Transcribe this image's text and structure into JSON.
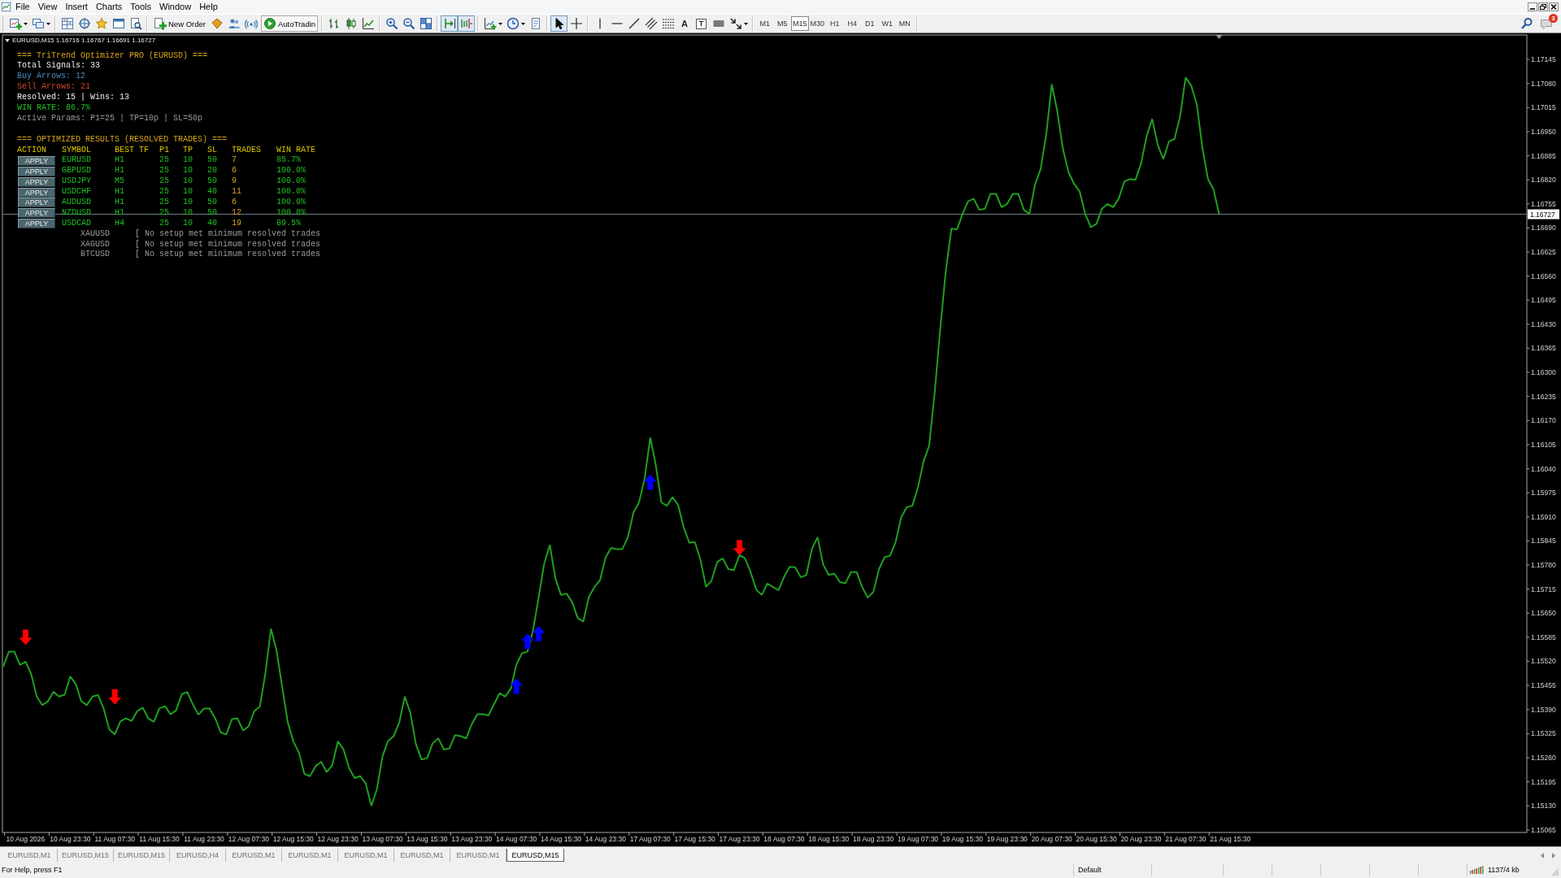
{
  "menu": [
    "File",
    "View",
    "Insert",
    "Charts",
    "Tools",
    "Window",
    "Help"
  ],
  "toolbar": {
    "new_order": "New Order",
    "autotrading": "AutoTradin",
    "autoscroll_on": true,
    "chart_shift_on": true,
    "cursor_modes": [
      {
        "kind": "cursor",
        "selected": true
      },
      {
        "kind": "crosshair",
        "selected": false
      }
    ],
    "text_tool": "A",
    "label_tool": "T",
    "timeframes": [
      {
        "label": "M1",
        "selected": false
      },
      {
        "label": "M5",
        "selected": false
      },
      {
        "label": "M15",
        "selected": true
      },
      {
        "label": "M30",
        "selected": false
      },
      {
        "label": "H1",
        "selected": false
      },
      {
        "label": "H4",
        "selected": false
      },
      {
        "label": "D1",
        "selected": false
      },
      {
        "label": "W1",
        "selected": false
      },
      {
        "label": "MN",
        "selected": false
      }
    ],
    "notifications": "3"
  },
  "chart": {
    "header": "EURUSD,M15 1.16716 1.16767 1.16691 1.16727",
    "chart_data": {
      "type": "line",
      "categories": [
        null,
        null,
        null,
        null,
        "10 Aug 2026",
        null,
        null,
        null,
        null,
        null,
        null,
        null,
        "10 Aug 23:30",
        null,
        null,
        null,
        null,
        null,
        null,
        null,
        "11 Aug 07:30",
        null,
        null,
        null,
        null,
        null,
        null,
        null,
        "11 Aug 15:30",
        null,
        null,
        null,
        null,
        null,
        null,
        null,
        "11 Aug 23:30",
        null,
        null,
        null,
        null,
        null,
        null,
        null,
        "12 Aug 07:30",
        null,
        null,
        null,
        null,
        null,
        null,
        null,
        "12 Aug 15:30",
        null,
        null,
        null,
        null,
        null,
        null,
        null,
        "12 Aug 23:30",
        null,
        null,
        null,
        null,
        null,
        null,
        null,
        "13 Aug 07:30",
        null,
        null,
        null,
        null,
        null,
        null,
        null,
        "13 Aug 15:30",
        null,
        null,
        null,
        null,
        null,
        null,
        null,
        "13 Aug 23:30",
        null,
        null,
        null,
        null,
        null,
        null,
        null,
        "14 Aug 07:30",
        null,
        null,
        null,
        null,
        null,
        null,
        null,
        "14 Aug 15:30",
        null,
        null,
        null,
        null,
        null,
        null,
        null,
        "14 Aug 23:30",
        null,
        null,
        null,
        null,
        null,
        null,
        null,
        "17 Aug 07:30",
        null,
        null,
        null,
        null,
        null,
        null,
        null,
        "17 Aug 15:30",
        null,
        null,
        null,
        null,
        null,
        null,
        null,
        "17 Aug 23:30",
        null,
        null,
        null,
        null,
        null,
        null,
        null,
        "18 Aug 07:30",
        null,
        null,
        null,
        null,
        null,
        null,
        null,
        "18 Aug 15:30",
        null,
        null,
        null,
        null,
        null,
        null,
        null,
        "18 Aug 23:30",
        null,
        null,
        null,
        null,
        null,
        null,
        null,
        "19 Aug 07:30",
        null,
        null,
        null,
        null,
        null,
        null,
        null,
        "19 Aug 15:30",
        null,
        null,
        null,
        null,
        null,
        null,
        null,
        "19 Aug 23:30",
        null,
        null,
        null,
        null,
        null,
        null,
        null,
        "20 Aug 07:30",
        null,
        null,
        null,
        null,
        null,
        null,
        null,
        "20 Aug 15:30",
        null,
        null,
        null,
        null,
        null,
        null,
        null,
        "20 Aug 23:30",
        null,
        null,
        null,
        null,
        null,
        null,
        null,
        "21 Aug 07:30",
        null,
        null,
        null,
        null,
        null,
        null,
        null,
        "21 Aug 15:30"
      ],
      "series": [
        {
          "type": "line",
          "color": "#1fa01f",
          "values": [
            1.15506,
            1.15546,
            1.15546,
            1.1551,
            1.15519,
            1.15486,
            1.15425,
            1.15402,
            1.15412,
            1.15438,
            1.15425,
            1.1543,
            1.15479,
            1.15459,
            1.15412,
            1.15402,
            1.15425,
            1.15429,
            1.15393,
            1.15336,
            1.15323,
            1.15358,
            1.15366,
            1.15359,
            1.15385,
            1.15395,
            1.15366,
            1.15357,
            1.15393,
            1.15399,
            1.15377,
            1.15388,
            1.15431,
            1.15437,
            1.15404,
            1.15376,
            1.15393,
            1.15393,
            1.15366,
            1.15328,
            1.15323,
            1.15364,
            1.15366,
            1.15333,
            1.15345,
            1.15385,
            1.15398,
            1.15487,
            1.15608,
            1.1555,
            1.15452,
            1.15356,
            1.15304,
            1.15274,
            1.15216,
            1.1521,
            1.15237,
            1.15249,
            1.15221,
            1.1524,
            1.15304,
            1.15282,
            1.15232,
            1.15205,
            1.1521,
            1.1519,
            1.1513,
            1.15175,
            1.15264,
            1.15305,
            1.15318,
            1.15355,
            1.15425,
            1.1538,
            1.15296,
            1.15255,
            1.15259,
            1.15299,
            1.15312,
            1.15282,
            1.15285,
            1.15321,
            1.15318,
            1.15312,
            1.1535,
            1.15377,
            1.15377,
            1.15374,
            1.15404,
            1.15434,
            1.15425,
            1.15446,
            1.15511,
            1.15542,
            1.15546,
            1.15604,
            1.15694,
            1.15784,
            1.15834,
            1.15744,
            1.15699,
            1.15703,
            1.1568,
            1.15637,
            1.15627,
            1.15694,
            1.15721,
            1.15739,
            1.15801,
            1.15826,
            1.15823,
            1.15823,
            1.15855,
            1.15922,
            1.15949,
            1.16014,
            1.16124,
            1.1605,
            1.15949,
            1.1594,
            1.15963,
            1.15942,
            1.15882,
            1.1584,
            1.15842,
            1.15795,
            1.15721,
            1.15738,
            1.15788,
            1.15798,
            1.15769,
            1.15766,
            1.15807,
            1.15798,
            1.15761,
            1.15714,
            1.15699,
            1.1573,
            1.15721,
            1.15712,
            1.15748,
            1.15775,
            1.15774,
            1.15747,
            1.15753,
            1.15824,
            1.15855,
            1.15782,
            1.15753,
            1.15757,
            1.15734,
            1.15731,
            1.15761,
            1.15761,
            1.15721,
            1.15692,
            1.15707,
            1.15768,
            1.15801,
            1.15805,
            1.15842,
            1.15909,
            1.15936,
            1.1594,
            1.15989,
            1.16059,
            1.16102,
            1.16244,
            1.16419,
            1.16573,
            1.16688,
            1.16686,
            1.16728,
            1.16762,
            1.16769,
            1.16739,
            1.16742,
            1.16782,
            1.16782,
            1.16746,
            1.16755,
            1.16782,
            1.16782,
            1.16739,
            1.16728,
            1.16808,
            1.16849,
            1.16941,
            1.17078,
            1.17004,
            1.16903,
            1.1684,
            1.16809,
            1.16788,
            1.16728,
            1.16692,
            1.16701,
            1.16742,
            1.16755,
            1.16746,
            1.16769,
            1.16815,
            1.16822,
            1.1682,
            1.16863,
            1.16937,
            1.16984,
            1.16914,
            1.16876,
            1.16923,
            1.1693,
            1.16991,
            1.17096,
            1.17074,
            1.17024,
            1.16907,
            1.16822,
            1.16794,
            1.16727,
            null,
            null
          ]
        }
      ],
      "yticks": [
        1.17145,
        {
          "value": 1.1708,
          "label": "1.17080"
        },
        1.17015,
        {
          "value": 1.1695,
          "label": "1.16950"
        },
        1.16885,
        {
          "value": 1.1682,
          "label": "1.16820"
        },
        1.16755,
        {
          "value": 1.1669,
          "label": "1.16690"
        },
        1.16625,
        {
          "value": 1.1656,
          "label": "1.16560"
        },
        1.16495,
        {
          "value": 1.1643,
          "label": "1.16430"
        },
        1.16365,
        {
          "value": 1.163,
          "label": "1.16300"
        },
        1.16235,
        {
          "value": 1.1617,
          "label": "1.16170"
        },
        1.16105,
        {
          "value": 1.1604,
          "label": "1.16040"
        },
        1.15975,
        {
          "value": 1.1591,
          "label": "1.15910"
        },
        1.15845,
        {
          "value": 1.1578,
          "label": "1.15780"
        },
        1.15715,
        {
          "value": 1.1565,
          "label": "1.15650"
        },
        1.15585,
        {
          "value": 1.1552,
          "label": "1.15520"
        },
        1.15455,
        {
          "value": 1.1539,
          "label": "1.15390"
        },
        1.15325,
        {
          "value": 1.1526,
          "label": "1.15260"
        },
        1.15195,
        {
          "value": 1.1513,
          "label": "1.15130"
        },
        1.15065
      ],
      "ylim": [
        1.15058,
        1.17211
      ],
      "ref_lines": [
        {
          "axis": "y",
          "value": 1.16727,
          "label": "1.16727",
          "color": "#6e7f8c"
        }
      ]
    }
  },
  "panel": {
    "title": "=== TriTrend Optimizer PRO (EURUSD) ===",
    "total_signals": "Total Signals: 33",
    "buy_arrows": "Buy Arrows: 12",
    "sell_arrows": "Sell Arrows: 21",
    "resolved": "Resolved: 15 | Wins: 13",
    "win_rate": "WIN RATE: 86.7%",
    "active_params": "Active Params: P1=25 | TP=10p | SL=50p",
    "results_title": "=== OPTIMIZED RESULTS (RESOLVED TRADES) ===",
    "columns": [
      "ACTION",
      "SYMBOL",
      "BEST TF",
      "P1",
      "TP",
      "SL",
      "TRADES",
      "WIN RATE"
    ],
    "rows": [
      {
        "action": "APPLY",
        "symbol": "EURUSD",
        "tf": "H1",
        "p1": "25",
        "tp": "10",
        "sl": "50",
        "trades": "7",
        "win_rate": "85.7%"
      },
      {
        "action": "APPLY",
        "symbol": "GBPUSD",
        "tf": "H1",
        "p1": "25",
        "tp": "10",
        "sl": "20",
        "trades": "6",
        "win_rate": "100.0%"
      },
      {
        "action": "APPLY",
        "symbol": "USDJPY",
        "tf": "M5",
        "p1": "25",
        "tp": "10",
        "sl": "50",
        "trades": "9",
        "win_rate": "100.0%"
      },
      {
        "action": "APPLY",
        "symbol": "USDCHF",
        "tf": "H1",
        "p1": "25",
        "tp": "10",
        "sl": "40",
        "trades": "11",
        "win_rate": "100.0%"
      },
      {
        "action": "APPLY",
        "symbol": "AUDUSD",
        "tf": "H1",
        "p1": "25",
        "tp": "10",
        "sl": "50",
        "trades": "6",
        "win_rate": "100.0%"
      },
      {
        "action": "APPLY",
        "symbol": "NZDUSD",
        "tf": "H1",
        "p1": "25",
        "tp": "10",
        "sl": "50",
        "trades": "12",
        "win_rate": "100.0%"
      },
      {
        "action": "APPLY",
        "symbol": "USDCAD",
        "tf": "H4",
        "p1": "25",
        "tp": "10",
        "sl": "40",
        "trades": "19",
        "win_rate": "89.5%"
      }
    ],
    "unresolved": [
      {
        "symbol": "XAUUSD",
        "message": "[ No setup met minimum resolved trades"
      },
      {
        "symbol": "XAGUSD",
        "message": "[ No setup met minimum resolved trades"
      },
      {
        "symbol": "BTCUSD",
        "message": "[ No setup met minimum resolved trades"
      }
    ]
  },
  "tabs": [
    {
      "label": "EURUSD,M1",
      "selected": false
    },
    {
      "label": "EURUSD,M15",
      "selected": false
    },
    {
      "label": "EURUSD,M15",
      "selected": false
    },
    {
      "label": "EURUSD,H4",
      "selected": false
    },
    {
      "label": "EURUSD,M1",
      "selected": false
    },
    {
      "label": "EURUSD,M1",
      "selected": false
    },
    {
      "label": "EURUSD,M1",
      "selected": false
    },
    {
      "label": "EURUSD,M1",
      "selected": false
    },
    {
      "label": "EURUSD,M1",
      "selected": false
    },
    {
      "label": "EURUSD,M15",
      "selected": true
    }
  ],
  "status_bar": {
    "help": "For Help, press F1",
    "profile": "Default",
    "traffic": "1137/4 kb"
  }
}
